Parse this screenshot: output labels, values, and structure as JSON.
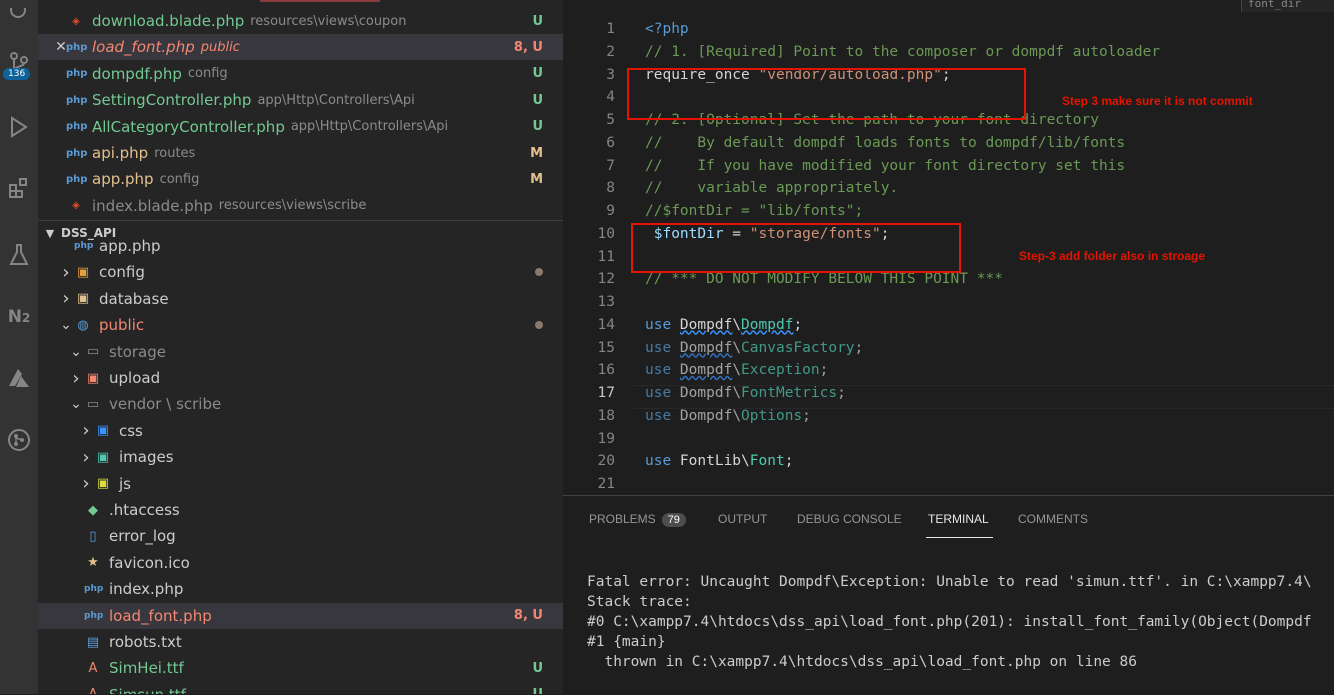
{
  "activity_bar": {
    "scm_badge": "136"
  },
  "open_editors": [
    {
      "name": "download.blade.php",
      "path": "resources\\views\\coupon",
      "status": "U",
      "type": "blade"
    },
    {
      "name": "load_font.php",
      "path": "public",
      "status": "8, U",
      "type": "php",
      "selected": true
    },
    {
      "name": "dompdf.php",
      "path": "config",
      "status": "U",
      "type": "php"
    },
    {
      "name": "SettingController.php",
      "path": "app\\Http\\Controllers\\Api",
      "status": "U",
      "type": "php"
    },
    {
      "name": "AllCategoryController.php",
      "path": "app\\Http\\Controllers\\Api",
      "status": "U",
      "type": "php"
    },
    {
      "name": "api.php",
      "path": "routes",
      "status": "M",
      "type": "php"
    },
    {
      "name": "app.php",
      "path": "config",
      "status": "M",
      "type": "php"
    },
    {
      "name": "index.blade.php",
      "path": "resources\\views\\scribe",
      "status": "",
      "type": "blade"
    }
  ],
  "explorer": {
    "section_title": "DSS_API",
    "items": [
      {
        "label": "app.php",
        "indent": 1
      },
      {
        "label": "config",
        "indent": 1
      },
      {
        "label": "database",
        "indent": 1
      },
      {
        "label": "public",
        "indent": 1
      },
      {
        "label": "storage",
        "indent": 2
      },
      {
        "label": "upload",
        "indent": 2
      },
      {
        "label": "vendor \\ scribe",
        "indent": 2
      },
      {
        "label": "css",
        "indent": 3
      },
      {
        "label": "images",
        "indent": 3
      },
      {
        "label": "js",
        "indent": 3
      },
      {
        "label": ".htaccess",
        "indent": 2
      },
      {
        "label": "error_log",
        "indent": 2
      },
      {
        "label": "favicon.ico",
        "indent": 2
      },
      {
        "label": "index.php",
        "indent": 2
      },
      {
        "label": "load_font.php",
        "indent": 2,
        "status": "8, U",
        "selected": true
      },
      {
        "label": "robots.txt",
        "indent": 2
      },
      {
        "label": "SimHei.ttf",
        "indent": 2,
        "status": "U"
      },
      {
        "label": "Simsun.ttf",
        "indent": 2,
        "status": "U"
      }
    ]
  },
  "editor": {
    "tab_hint": "font_dir",
    "line_numbers": [
      "1",
      "2",
      "3",
      "4",
      "5",
      "6",
      "7",
      "8",
      "9",
      "10",
      "11",
      "12",
      "13",
      "14",
      "15",
      "16",
      "17",
      "18",
      "19",
      "20",
      "21"
    ],
    "active_line": "17",
    "code": {
      "l1": "<?php",
      "l2": "// 1. [Required] Point to the composer or dompdf autoloader",
      "l3a": "require_once ",
      "l3b": "\"vendor/autoload.php\"",
      "l3c": ";",
      "l5": "// 2. [Optional] Set the path to your font directory",
      "l6": "//    By default dompdf loads fonts to dompdf/lib/fonts",
      "l7": "//    If you have modified your font directory set this",
      "l8": "//    variable appropriately.",
      "l9": "//$fontDir = \"lib/fonts\";",
      "l10a": "$fontDir",
      "l10b": " = ",
      "l10c": "\"storage/fonts\"",
      "l10d": ";",
      "l12": "// *** DO NOT MODIFY BELOW THIS POINT ***",
      "use": "use ",
      "l14a": "Dompdf",
      "l14b": "Dompdf",
      "l15a": "Dompdf",
      "l15b": "CanvasFactory",
      "l16a": "Dompdf",
      "l16b": "Exception",
      "l17a": "Dompdf",
      "l17b": "FontMetrics",
      "l18a": "Dompdf",
      "l18b": "Options",
      "l20a": "FontLib",
      "l20b": "Font",
      "bs": "\\",
      "semi": ";"
    },
    "annotations": {
      "a1": "Step 3 make sure it is not commit",
      "a2": "Step-3 add folder also in stroage"
    }
  },
  "panel": {
    "tabs": [
      {
        "label": "PROBLEMS",
        "badge": "79"
      },
      {
        "label": "OUTPUT"
      },
      {
        "label": "DEBUG CONSOLE"
      },
      {
        "label": "TERMINAL",
        "active": true
      },
      {
        "label": "COMMENTS"
      }
    ],
    "terminal_lines": [
      "Fatal error: Uncaught Dompdf\\Exception: Unable to read 'simun.ttf'. in C:\\xampp7.4\\",
      "Stack trace:",
      "#0 C:\\xampp7.4\\htdocs\\dss_api\\load_font.php(201): install_font_family(Object(Dompdf",
      "#1 {main}",
      "  thrown in C:\\xampp7.4\\htdocs\\dss_api\\load_font.php on line 86"
    ]
  }
}
